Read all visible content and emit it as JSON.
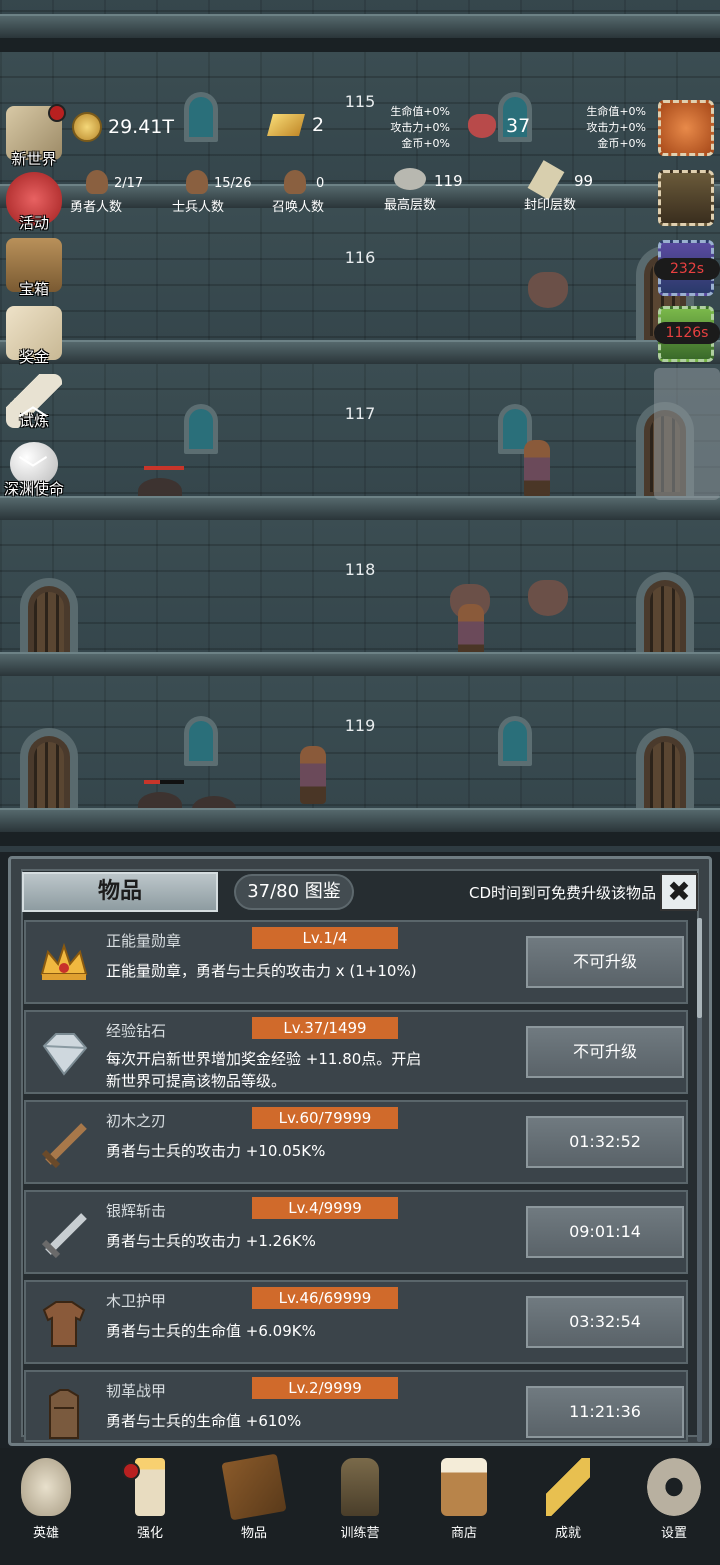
{
  "floors": [
    "115",
    "116",
    "117",
    "118",
    "119"
  ],
  "resources": {
    "coins": "29.41T",
    "gold_bars": "2",
    "gems": "37",
    "bonus_left": [
      "生命值+0%",
      "攻击力+0%",
      "金币+0%"
    ],
    "bonus_right": [
      "生命值+0%",
      "攻击力+0%",
      "金币+0%"
    ]
  },
  "stats": {
    "heroes": {
      "value": "2/17",
      "label": "勇者人数"
    },
    "soldiers": {
      "value": "15/26",
      "label": "士兵人数"
    },
    "summons": {
      "value": "0",
      "label": "召唤人数"
    },
    "max_floor": {
      "value": "119",
      "label": "最高层数"
    },
    "sealed_floor": {
      "value": "99",
      "label": "封印层数"
    }
  },
  "side_menu": [
    "新世界",
    "活动",
    "宝箱",
    "奖金",
    "试炼",
    "深渊使命"
  ],
  "timers": [
    "232s",
    "1126s"
  ],
  "panel": {
    "tab_title": "物品",
    "collection": "37/80 图鉴",
    "cd_tip": "CD时间到可免费升级该物品",
    "close": "✖"
  },
  "items": [
    {
      "name": "正能量勋章",
      "level": "Lv.1/4",
      "desc": "正能量勋章，勇者与士兵的攻击力 x (1+10%)",
      "button": "不可升级",
      "icon": "crown-medal-icon"
    },
    {
      "name": "经验钻石",
      "level": "Lv.37/1499",
      "desc": "每次开启新世界增加奖金经验 +11.80点。开启新世界可提高该物品等级。",
      "button": "不可升级",
      "icon": "diamond-icon"
    },
    {
      "name": "初木之刃",
      "level": "Lv.60/79999",
      "desc": "勇者与士兵的攻击力 +10.05K%",
      "button": "01:32:52",
      "icon": "wooden-sword-icon"
    },
    {
      "name": "银辉斩击",
      "level": "Lv.4/9999",
      "desc": "勇者与士兵的攻击力 +1.26K%",
      "button": "09:01:14",
      "icon": "silver-sword-icon"
    },
    {
      "name": "木卫护甲",
      "level": "Lv.46/69999",
      "desc": "勇者与士兵的生命值 +6.09K%",
      "button": "03:32:54",
      "icon": "wooden-armor-icon"
    },
    {
      "name": "韧革战甲",
      "level": "Lv.2/9999",
      "desc": "勇者与士兵的生命值 +610%",
      "button": "11:21:36",
      "icon": "leather-armor-icon"
    }
  ],
  "nav": [
    "英雄",
    "强化",
    "物品",
    "训练营",
    "商店",
    "成就",
    "设置"
  ],
  "colors": {
    "level_badge": "#d06a2b",
    "timer_text": "#e84040",
    "alert_dot": "#b82020"
  }
}
